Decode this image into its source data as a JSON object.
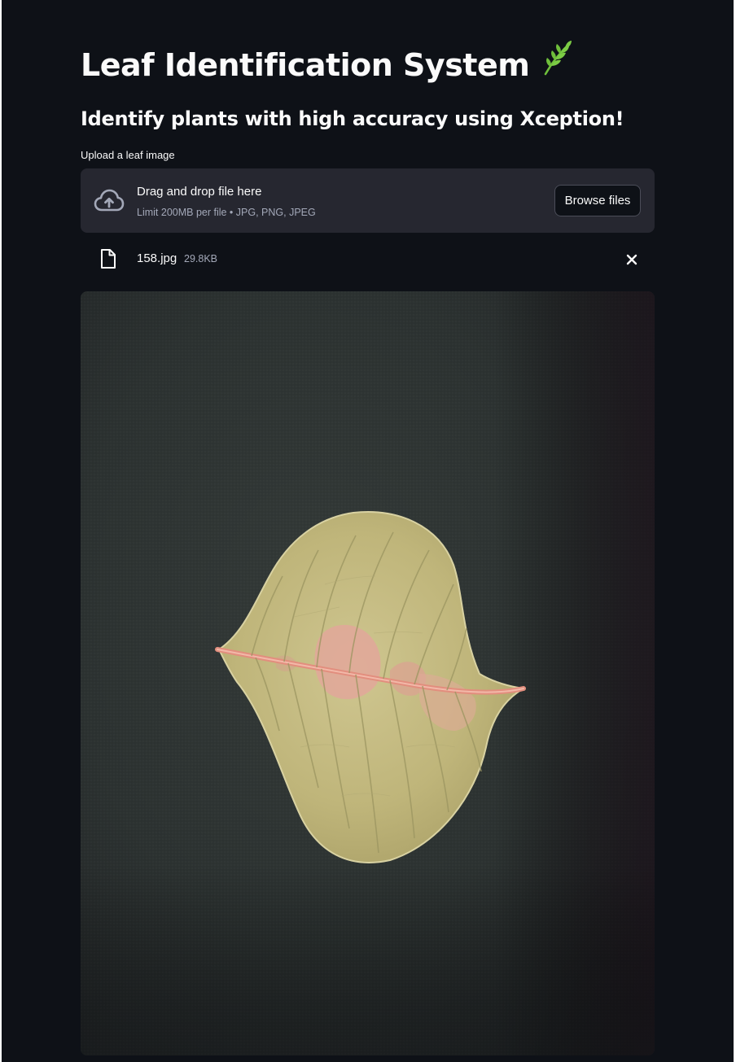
{
  "header": {
    "title": "Leaf Identification System",
    "title_emoji": "herb-icon",
    "subtitle": "Identify plants with high accuracy using Xception!"
  },
  "uploader": {
    "label": "Upload a leaf image",
    "dropzone_title": "Drag and drop file here",
    "dropzone_limit": "Limit 200MB per file • JPG, PNG, JPEG",
    "browse_label": "Browse files",
    "icon": "cloud-upload-icon"
  },
  "uploaded_file": {
    "name": "158.jpg",
    "size": "29.8KB",
    "icon": "file-icon",
    "remove_icon": "close-icon"
  },
  "preview": {
    "subject": "leaf-photo"
  },
  "colors": {
    "background": "#0e1117",
    "surface": "#262730",
    "text": "#fafafa",
    "muted_text": "#a3a8b8",
    "border": "#4b4d58"
  }
}
